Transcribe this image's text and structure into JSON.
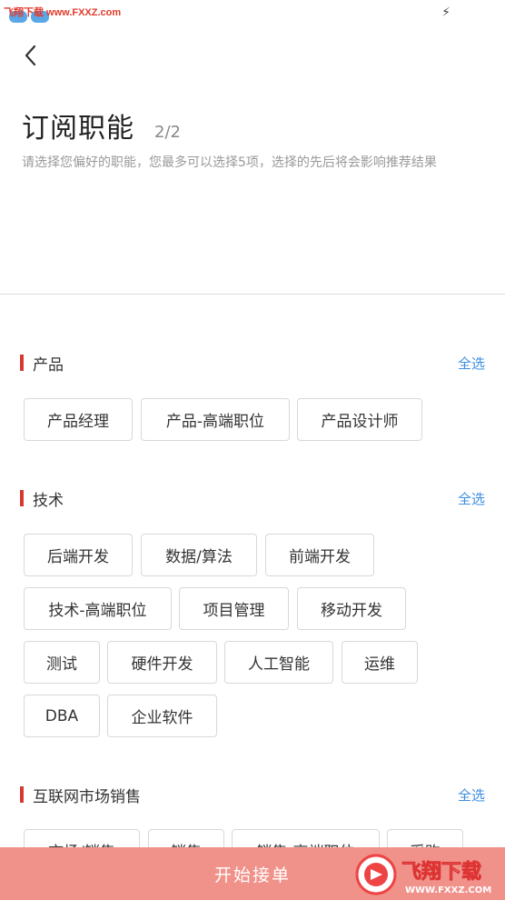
{
  "status_bar": {
    "watermark": "飞翔下载 www.FXXZ.com"
  },
  "header": {
    "title": "订阅职能",
    "step": "2/2",
    "subtitle": "请选择您偏好的职能，您最多可以选择5项，选择的先后将会影响推荐结果"
  },
  "sections": [
    {
      "title": "产品",
      "select_all": "全选",
      "tags": [
        "产品经理",
        "产品-高端职位",
        "产品设计师"
      ]
    },
    {
      "title": "技术",
      "select_all": "全选",
      "tags": [
        "后端开发",
        "数据/算法",
        "前端开发",
        "技术-高端职位",
        "项目管理",
        "移动开发",
        "测试",
        "硬件开发",
        "人工智能",
        "运维",
        "DBA",
        "企业软件"
      ]
    },
    {
      "title": "互联网市场销售",
      "select_all": "全选",
      "tags": [
        "市场/销售",
        "销售",
        "销售-高端职位",
        "采购"
      ]
    }
  ],
  "bottom_button": {
    "label": "开始接单"
  },
  "watermark_logo": {
    "text": "飞翔下载",
    "url": "WWW.FXXZ.COM"
  },
  "colors": {
    "accent_bar": "#d33b32",
    "link": "#3d8ee0",
    "button": "#f0918a"
  }
}
